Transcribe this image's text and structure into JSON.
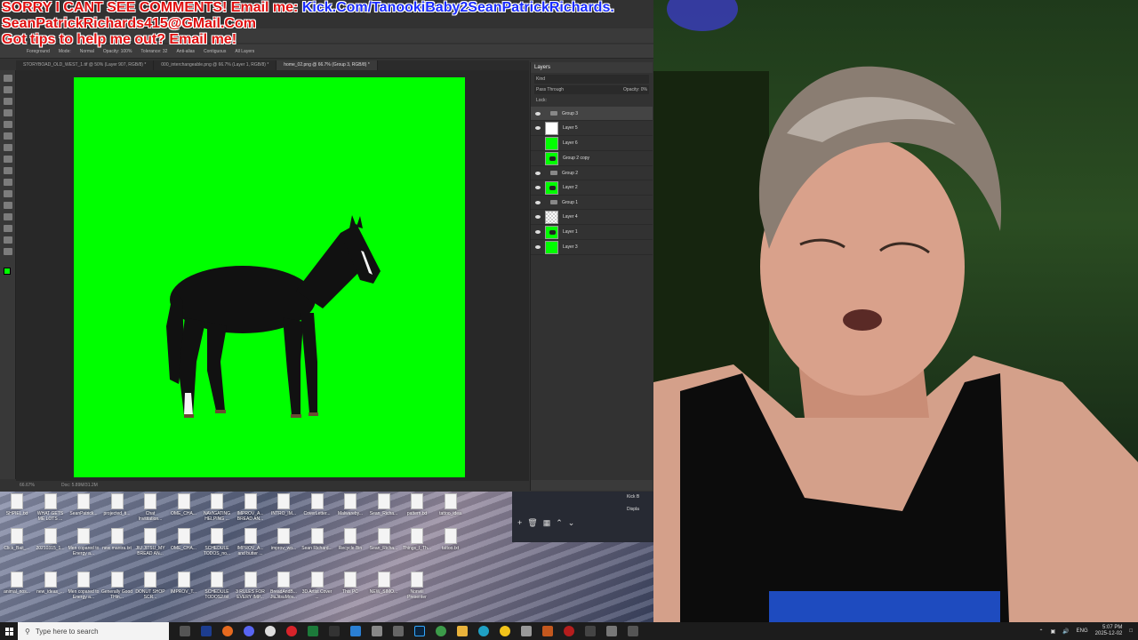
{
  "overlay": {
    "line1_red": "SORRY I CANT SEE COMMENTS! Email me:",
    "line1_blue": "Kick.Com/TanookiBaby2",
    "line1_red2": "SeanPatrickRichards.",
    "line2": "SeanPatrickRichards415@GMail.Com",
    "line3": "Got tips to help me out? Email me!"
  },
  "photoshop": {
    "options": {
      "tool_label": "Foreground",
      "mode_label": "Mode:",
      "mode_value": "Normal",
      "opacity_label": "Opacity: 100%",
      "tolerance_label": "Tolerance: 32",
      "antialias": "Anti-alias",
      "contiguous": "Contiguous",
      "all_layers": "All Layers"
    },
    "tabs": [
      "STORYBOAD_OLD_WEST_1.tif @ 50% (Layer 907, RGB/8) *",
      "000_interchangeable.png @ 66.7% (Layer 1, RGB/8) *",
      "home_02.png @ 66.7% (Group 3, RGB/8) *"
    ],
    "status_zoom": "66.67%",
    "status_doc": "Doc: 5.89M/31.2M",
    "layers_panel": {
      "title": "Layers",
      "filter": "Kind",
      "blend": "Pass Through",
      "opacity": "Opacity: 0%",
      "lock": "Lock:",
      "layers": [
        {
          "name": "Group 3",
          "kind": "group",
          "eye": true,
          "thumb": "none"
        },
        {
          "name": "Layer 5",
          "kind": "layer",
          "eye": true,
          "thumb": "white"
        },
        {
          "name": "Layer 6",
          "kind": "layer",
          "eye": false,
          "thumb": "green"
        },
        {
          "name": "Group 2 copy",
          "kind": "layer",
          "eye": false,
          "thumb": "horse"
        },
        {
          "name": "Group 2",
          "kind": "group",
          "eye": true,
          "thumb": "none"
        },
        {
          "name": "Layer 2",
          "kind": "layer",
          "eye": true,
          "thumb": "horse"
        },
        {
          "name": "Group 1",
          "kind": "group",
          "eye": true,
          "thumb": "none"
        },
        {
          "name": "Layer 4",
          "kind": "layer",
          "eye": true,
          "thumb": "checker"
        },
        {
          "name": "Layer 1",
          "kind": "layer",
          "eye": true,
          "thumb": "horse"
        },
        {
          "name": "Layer 3",
          "kind": "layer",
          "eye": true,
          "thumb": "green"
        }
      ]
    }
  },
  "desktop": {
    "icons_row1": [
      "SHPIEL.txt",
      "WHAT GETS ME LOTS ...",
      "SeanPatrick...",
      "projected_ti...",
      "Chat Invititation...",
      "OME_CHA...",
      "NAVIGATING HELPING ...",
      "IMPROV_A... BREAD AN...",
      "INTRO_IM...",
      "CoverLetter...",
      "Malwareby...",
      "Sean_Richa...",
      "pattern.txt",
      "tattoo_idea"
    ],
    "icons_row2": [
      "Click_Bait_...",
      "20210315_1...",
      "Men copared to Energy a...",
      "new mantra.txt",
      "JIU JITSU_MY BREAD AN...",
      "OME_CHA...",
      "SCHEDULE TODOS_no...",
      "IMPROV_A... and butter ...",
      "improv_wo...",
      "Sean Richard...",
      "Recycle Bin",
      "Sean_Richa...",
      "Things_I_Th...",
      "tattoo.txt"
    ],
    "icons_row3": [
      "animal_nos...",
      "new_ideas_...",
      "Men copared to Energy a...",
      "Generally Good THin...",
      "DONUT SHOP SCR...",
      "IMPROV_T...",
      "SCHEDULE TODOS2.txt",
      "3 RULES FOR EVERY IMP...",
      "BreadAndB... JiuJitsuMov...",
      "3D Artist Cover ...",
      "This PC",
      "NEW_SIMO...",
      "Nonviii Presenter"
    ],
    "obs_right_1": "Kick B",
    "obs_right_2": "Displa"
  },
  "taskbar": {
    "search_placeholder": "Type here to search",
    "lang": "ENG",
    "time": "5:07 PM",
    "date": "2025-12-02"
  },
  "colors": {
    "canvas_green": "#00ff00",
    "overlay_red": "#e01010",
    "overlay_blue": "#1a2cff"
  }
}
